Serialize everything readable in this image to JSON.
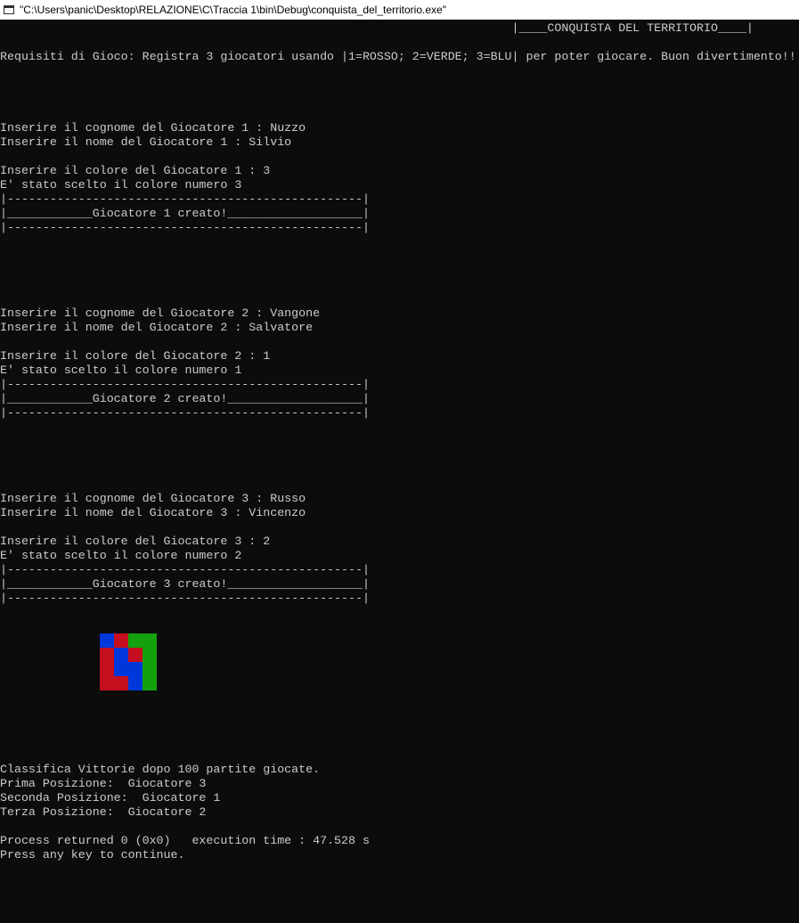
{
  "window": {
    "title": "\"C:\\Users\\panic\\Desktop\\RELAZIONE\\C\\Traccia 1\\bin\\Debug\\conquista_del_territorio.exe\""
  },
  "console": {
    "lines": [
      "                                                                        |____CONQUISTA DEL TERRITORIO____|",
      "",
      "Requisiti di Gioco: Registra 3 giocatori usando |1=ROSSO; 2=VERDE; 3=BLU| per poter giocare. Buon divertimento!!",
      "",
      "",
      "",
      "",
      "Inserire il cognome del Giocatore 1 : Nuzzo",
      "Inserire il nome del Giocatore 1 : Silvio",
      "",
      "Inserire il colore del Giocatore 1 : 3",
      "E' stato scelto il colore numero 3",
      "|--------------------------------------------------|",
      "|____________Giocatore 1 creato!___________________|",
      "|--------------------------------------------------|",
      "",
      "",
      "",
      "",
      "",
      "Inserire il cognome del Giocatore 2 : Vangone",
      "Inserire il nome del Giocatore 2 : Salvatore",
      "",
      "Inserire il colore del Giocatore 2 : 1",
      "E' stato scelto il colore numero 1",
      "|--------------------------------------------------|",
      "|____________Giocatore 2 creato!___________________|",
      "|--------------------------------------------------|",
      "",
      "",
      "",
      "",
      "",
      "Inserire il cognome del Giocatore 3 : Russo",
      "Inserire il nome del Giocatore 3 : Vincenzo",
      "",
      "Inserire il colore del Giocatore 3 : 2",
      "E' stato scelto il colore numero 2",
      "|--------------------------------------------------|",
      "|____________Giocatore 3 creato!___________________|",
      "|--------------------------------------------------|",
      "",
      "",
      "",
      "",
      "",
      "",
      "",
      "",
      "",
      "",
      "",
      "Classifica Vittorie dopo 100 partite giocate.",
      "Prima Posizione:  Giocatore 3",
      "Seconda Posizione:  Giocatore 1",
      "Terza Posizione:  Giocatore 2",
      "",
      "Process returned 0 (0x0)   execution time : 47.528 s",
      "Press any key to continue."
    ]
  },
  "territory_grid": {
    "colors": {
      "1": "#c50f1f",
      "2": "#13a10e",
      "3": "#0037da"
    },
    "cells": [
      [
        3,
        1,
        2,
        2
      ],
      [
        1,
        3,
        1,
        2
      ],
      [
        1,
        3,
        3,
        2
      ],
      [
        1,
        1,
        3,
        2
      ]
    ]
  }
}
